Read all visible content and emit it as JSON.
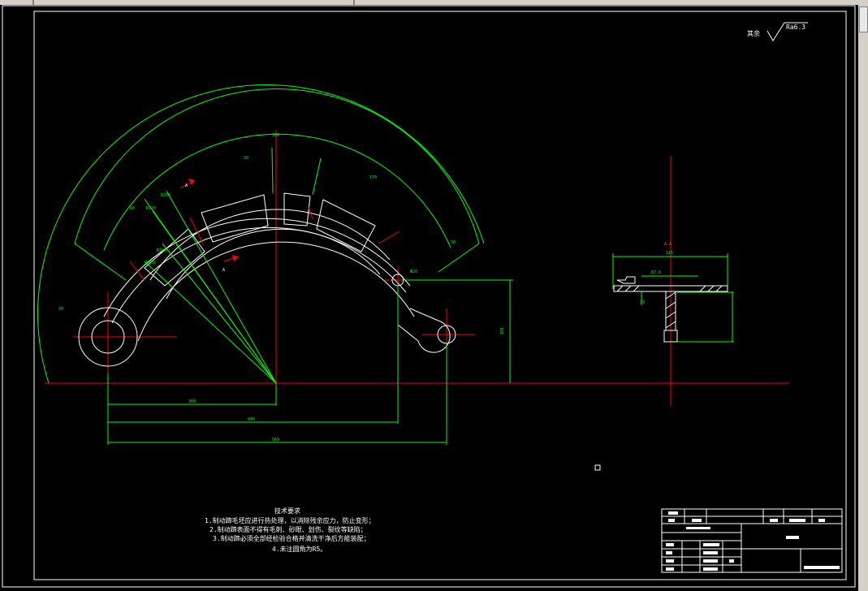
{
  "roughness": {
    "label": "其余",
    "value": "Ra6.3"
  },
  "notes": {
    "title": "技术要求",
    "items": [
      "1.制动蹄毛坯应进行热处理，以消除残余应力，防止变形；",
      "2.制动蹄表面不得有毛刺、砂眼、划伤、裂纹等缺陷；",
      "3.制动蹄必须全部经检验合格并清洗干净后方能装配；",
      "4.未注圆角为R5。"
    ]
  },
  "section": {
    "label": "A-A",
    "dim_top": "115",
    "dim_mid": "87.6",
    "dim_small": "30"
  },
  "dims": {
    "d_360": "360",
    "d_498": "498",
    "d_569": "569",
    "d_181": "181",
    "arc_outer": "180",
    "arc_a": "30",
    "arc_b": "60",
    "arc_c": "170",
    "arc_d": "30",
    "arc_e": "30",
    "r_a": "R220",
    "r_b": "R250",
    "r_c": "R300",
    "r_d": "R350",
    "hole": "Φ20",
    "label_a1": "A",
    "label_a2": "A"
  },
  "colors": {
    "outline": "#ffffff",
    "dimension": "#00ff00",
    "center": "#ff0000"
  }
}
